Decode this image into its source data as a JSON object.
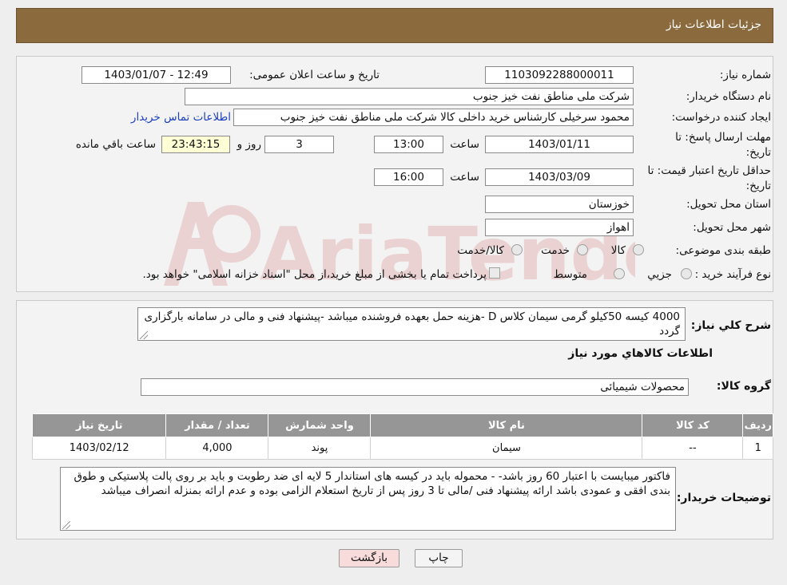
{
  "header": {
    "title": "جزئیات اطلاعات نیاز"
  },
  "form": {
    "need_number_label": "شماره نیاز:",
    "need_number": "1103092288000011",
    "announce_label": "تاریخ و ساعت اعلان عمومی:",
    "announce_value": "1403/01/07 - 12:49",
    "buyer_org_label": "نام دستگاه خریدار:",
    "buyer_org": "شرکت ملی مناطق نفت خیز جنوب",
    "creator_label": "ایجاد کننده درخواست:",
    "creator": "محمود سرخیلی کارشناس خرید داخلی کالا شرکت ملی مناطق نفت خیز جنوب",
    "contact_link": "اطلاعات تماس خریدار",
    "deadline_label": "مهلت ارسال پاسخ: تا تاریخ:",
    "deadline_date": "1403/01/11",
    "time_label": "ساعت",
    "deadline_time": "13:00",
    "days_value": "3",
    "days_label": "روز و",
    "remaining_value": "23:43:15",
    "remaining_label": "ساعت باقي مانده",
    "validity_label": "حداقل تاریخ اعتبار قیمت: تا تاریخ:",
    "validity_date": "1403/03/09",
    "validity_time": "16:00",
    "province_label": "استان محل تحویل:",
    "province": "خوزستان",
    "city_label": "شهر محل تحویل:",
    "city": "اهواز",
    "category_label": "طبقه بندی موضوعی:",
    "category_options": [
      "کالا",
      "خدمت",
      "کالا/خدمت"
    ],
    "process_label": "نوع فرآیند خرید :",
    "process_options": [
      "جزيي",
      "متوسط"
    ],
    "process_note": "پرداخت تمام یا بخشی از مبلغ خرید،از محل \"اسناد خزانه اسلامی\" خواهد بود."
  },
  "summary": {
    "label": "شرح کلي نياز:",
    "text": "4000 کیسه 50کیلو گرمی سیمان کلاس  D -هزینه حمل بعهده فروشنده میباشد -پیشنهاد فنی و مالی در سامانه بارگزاری گردد"
  },
  "goods_info_title": "اطلاعات کالاهاي مورد نياز",
  "goods_group": {
    "label": "گروه کالا:",
    "value": "محصولات شیمیائی"
  },
  "table": {
    "headers": [
      "رديف",
      "کد کالا",
      "نام کالا",
      "واحد شمارش",
      "تعداد / مقدار",
      "تاریخ نیاز"
    ],
    "rows": [
      {
        "row": "1",
        "code": "--",
        "name": "سیمان",
        "unit": "پوند",
        "qty": "4,000",
        "date": "1403/02/12"
      }
    ]
  },
  "buyer_notes": {
    "label": "توضیحات خریدار:",
    "text": "فاکتور میبایست با اعتبار 60 روز باشد- - محموله باید در کیسه های استاندار 5 لایه ای ضد رطوبت و باید بر روی پالت پلاستیکی و طوق بندی افقی و عمودی باشد ارائه پیشنهاد فنی /مالی تا 3 روز پس از تاریخ استعلام الزامی بوده و عدم ارائه بمنزله انصراف میباشد"
  },
  "buttons": {
    "print": "چاپ",
    "back": "بازگشت"
  },
  "watermark_text": "AriaTender.neT",
  "colors": {
    "header": "#8b6a3e",
    "table_header": "#969696",
    "remaining_bg": "#ffffd5",
    "back_button": "#f8dcdc",
    "link": "#1a3fbf"
  }
}
